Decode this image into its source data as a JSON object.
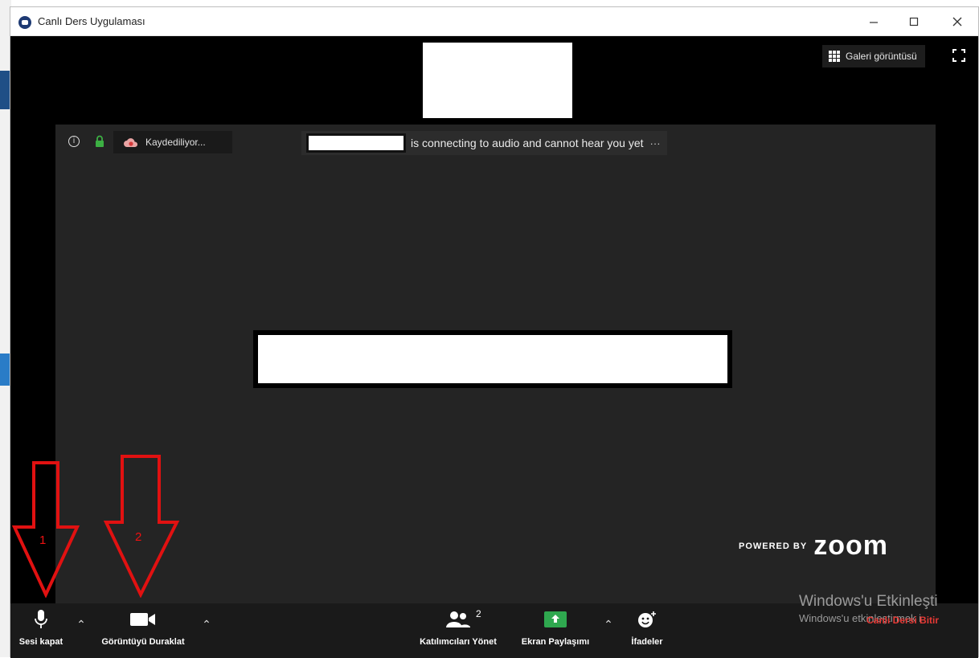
{
  "window": {
    "title": "Canlı Ders Uygulaması",
    "controls": [
      "minimize-icon",
      "maximize-icon",
      "close-icon"
    ]
  },
  "top": {
    "gallery_label": "Galeri görüntüsü"
  },
  "status": {
    "recording_label": "Kaydediliyor...",
    "notification_text": "is connecting to audio and cannot hear you yet",
    "notification_more": "···"
  },
  "branding": {
    "powered_by": "POWERED BY",
    "zoom": "zoom"
  },
  "toolbar": {
    "mute_label": "Sesi kapat",
    "video_label": "Görüntüyü Duraklat",
    "participants_label": "Katılımcıları Yönet",
    "participants_count": "2",
    "share_label": "Ekran Paylaşımı",
    "reactions_label": "İfadeler",
    "end_label": "Canlı Dersi Bitir"
  },
  "watermark": {
    "line1": "Windows'u Etkinleşti",
    "line2": "Windows'u etkinleştirmek i"
  },
  "annotations": {
    "arrow1": "1",
    "arrow2": "2"
  },
  "colors": {
    "annotation_red": "#e11111",
    "share_green": "#2fa84f",
    "end_red": "#e53935"
  }
}
